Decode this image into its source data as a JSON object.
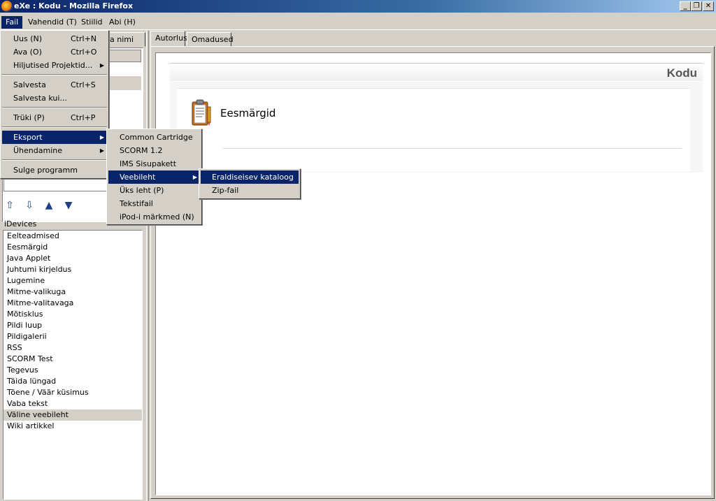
{
  "window": {
    "title": "eXe : Kodu - Mozilla Firefox",
    "min": "_",
    "max": "❐",
    "close": "✕"
  },
  "menubar": [
    "Fail",
    "Vahendid (T)",
    "Stiilid",
    "Abi (H)"
  ],
  "left": {
    "tab_label": "a nimi",
    "idevices_label": "iDevices",
    "arrows": [
      "⇧",
      "⇩",
      "▲",
      "▼"
    ],
    "idevices": [
      "Eelteadmised",
      "Eesmärgid",
      "Java Applet",
      "Juhtumi kirjeldus",
      "Lugemine",
      "Mitme-valikuga",
      "Mitme-valitavaga",
      "Mõtisklus",
      "Pildi luup",
      "Pildigalerii",
      "RSS",
      "SCORM Test",
      "Tegevus",
      "Täida lüngad",
      "Tõene / Väär küsimus",
      "Vaba tekst",
      "Väline veebileht",
      "Wiki artikkel"
    ],
    "selected_idevice": "Väline veebileht"
  },
  "right": {
    "tabs": [
      "Autorlus",
      "Omadused"
    ],
    "page_title": "Kodu",
    "idevice_title": "Eesmärgid"
  },
  "file_menu": {
    "items": [
      {
        "label": "Uus (N)",
        "accel": "Ctrl+N"
      },
      {
        "label": "Ava (O)",
        "accel": "Ctrl+O"
      },
      {
        "label": "Hiljutised Projektid...",
        "accel": ""
      },
      {
        "label": "Salvesta",
        "accel": "Ctrl+S"
      },
      {
        "label": "Salvesta kui...",
        "accel": ""
      },
      {
        "label": "Trüki (P)",
        "accel": "Ctrl+P"
      },
      {
        "label": "Eksport",
        "accel": ""
      },
      {
        "label": "Ühendamine",
        "accel": ""
      },
      {
        "label": "Sulge programm",
        "accel": ""
      }
    ]
  },
  "export_menu": [
    "Common Cartridge",
    "SCORM 1.2",
    "IMS Sisupakett",
    "Veebileht",
    "Üks leht (P)",
    "Tekstifail",
    "iPod-i märkmed (N)"
  ],
  "web_menu": [
    "Eraldiseisev kataloog",
    "Zip-fail"
  ],
  "submenu_arrow": "▶"
}
